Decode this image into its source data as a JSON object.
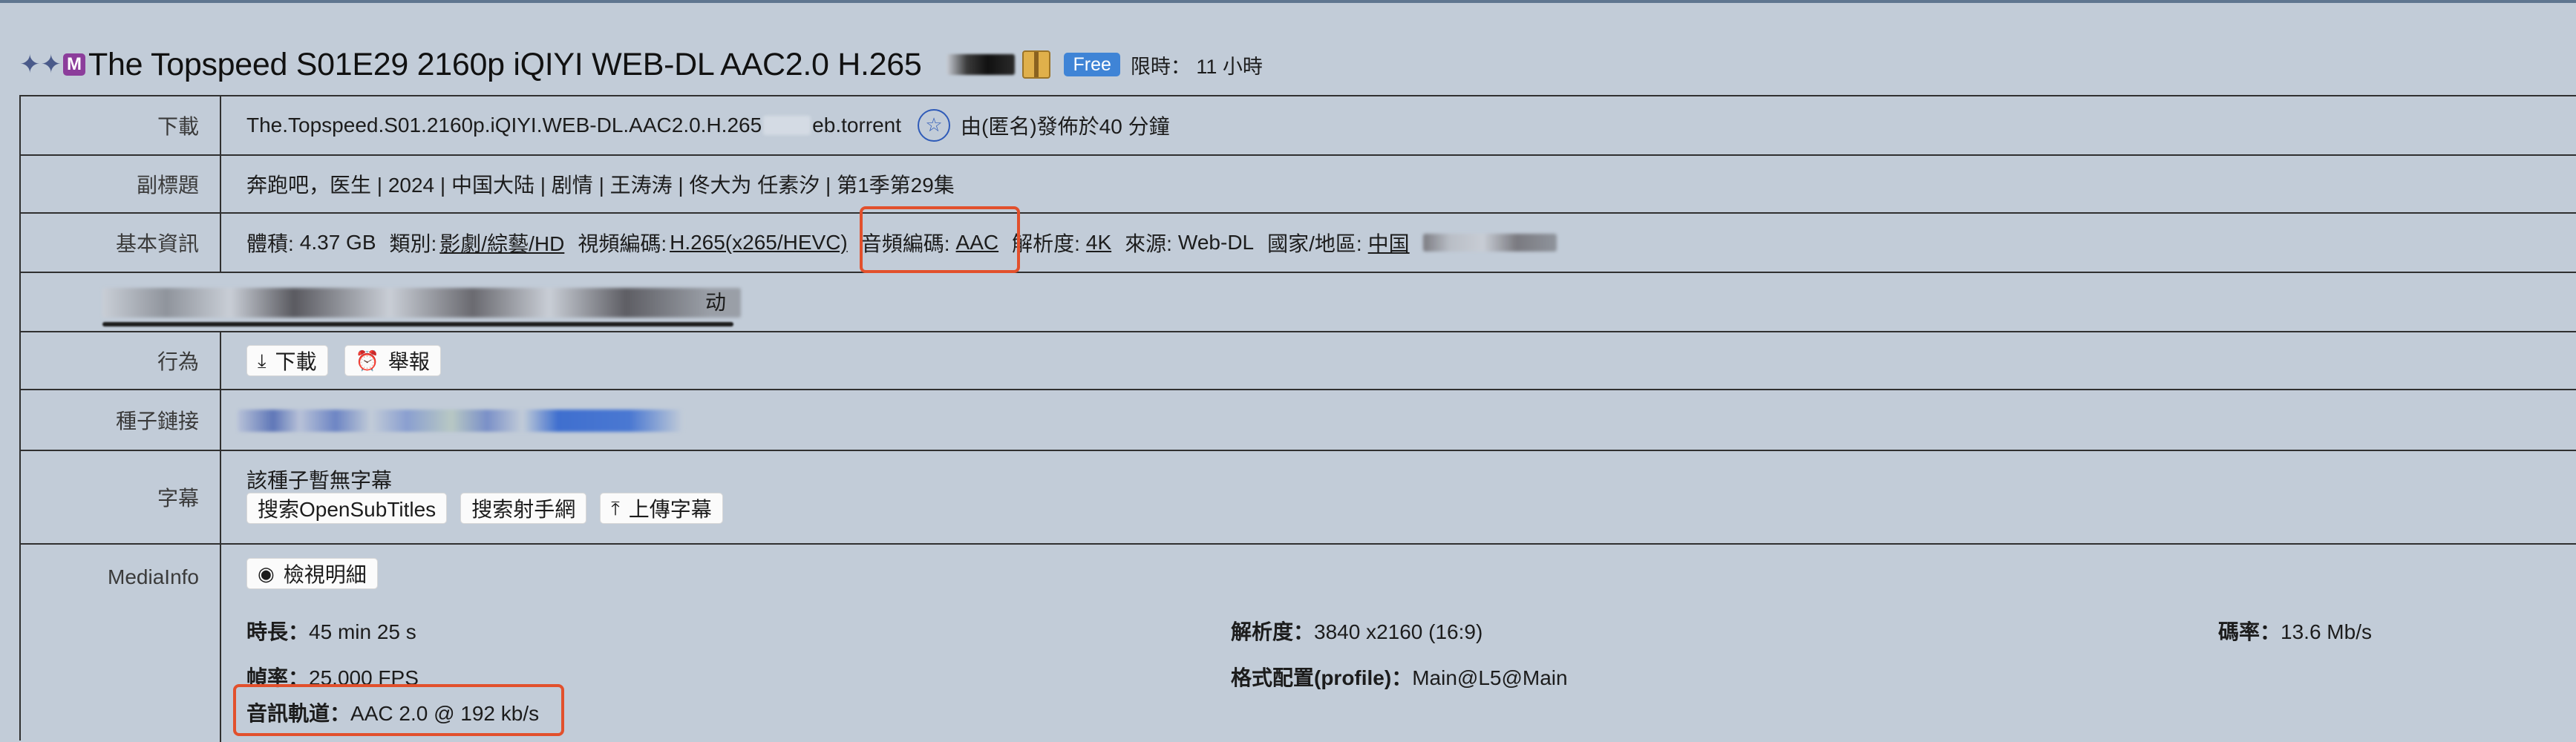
{
  "title": {
    "sparkles": "✦✦",
    "m_badge": "M",
    "text": "The Topspeed S01E29 2160p iQIYI WEB-DL AAC2.0 H.265",
    "free_badge": "Free",
    "limit": "限時： 11 小時"
  },
  "rows": {
    "download": {
      "label": "下載",
      "filename_prefix": "The.Topspeed.S01.2160p.iQIYI.WEB-DL.AAC2.0.H.265",
      "filename_suffix": "eb.torrent",
      "star_icon": "☆",
      "publish_info": "由(匿名)發佈於40 分鐘"
    },
    "subtitle": {
      "label": "副標題",
      "text": "奔跑吧，医生 | 2024 | 中国大陆 | 剧情 | 王涛涛 | 佟大为 任素汐 | 第1季第29集"
    },
    "basic": {
      "label": "基本資訊",
      "size_label": "體積:",
      "size_value": "4.37 GB",
      "category_label": "類別:",
      "category_value": "影劇/綜藝/HD",
      "video_label": "視頻編碼:",
      "video_value": "H.265(x265/HEVC)",
      "audio_label": "音頻編碼:",
      "audio_value": "AAC",
      "resolution_label": "解析度:",
      "resolution_value": "4K",
      "source_label": "來源:",
      "source_value": "Web-DL",
      "region_label": "國家/地區:",
      "region_value": "中国"
    },
    "blurred_row": {
      "tail": "动"
    },
    "actions": {
      "label": "行為",
      "download_btn": "下載",
      "report_btn": "舉報"
    },
    "magnet": {
      "label": "種子鏈接"
    },
    "subs": {
      "label": "字幕",
      "none_text": "該種子暫無字幕",
      "search_opensub": "搜索OpenSubTitles",
      "search_shooter": "搜索射手網",
      "upload": "上傳字幕"
    },
    "mediainfo": {
      "label": "MediaInfo",
      "view_btn": "檢視明細",
      "duration_label": "時長：",
      "duration_value": "45 min 25 s",
      "resolution_label": "解析度：",
      "resolution_value": "3840 x2160 (16:9)",
      "bitrate_label": "碼率：",
      "bitrate_value": "13.6 Mb/s",
      "framerate_label": "幀率：",
      "framerate_value": "25.000 FPS",
      "profile_label": "格式配置(profile)：",
      "profile_value": "Main@L5@Main",
      "audio_label": "音訊軌道：",
      "audio_value": "AAC 2.0 @ 192 kb/s"
    }
  },
  "colors": {
    "background": "#c2ccd8",
    "highlight": "#e2502c",
    "free_badge": "#3f84d6",
    "border": "#303030"
  }
}
